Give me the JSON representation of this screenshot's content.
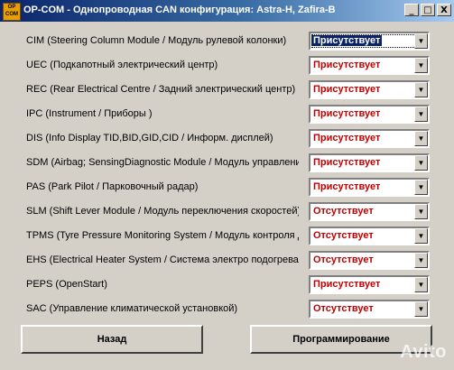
{
  "window": {
    "title": "OP-COM - Однопроводная  CAN конфигурация: Astra-H, Zafira-B",
    "app_icon_text": "OP COM",
    "controls": [
      "_",
      "□",
      "X"
    ]
  },
  "rows": [
    {
      "label": "CIM (Steering Column Module / Модуль рулевой колонки)",
      "value": "Присутствует"
    },
    {
      "label": "UEC (Подкапотный электрический центр)",
      "value": "Присутствует"
    },
    {
      "label": "REC (Rear Electrical Centre / Задний электрический центр)",
      "value": "Присутствует"
    },
    {
      "label": "IPC (Instrument / Приборы )",
      "value": "Присутствует"
    },
    {
      "label": "DIS (Info Display TID,BID,GID,CID / Информ. дисплей)",
      "value": "Присутствует"
    },
    {
      "label": "SDM (Airbag; SensingDiagnostic Module / Модуль управления",
      "value": "Присутствует"
    },
    {
      "label": "PAS (Park Pilot / Парковочный радар)",
      "value": "Присутствует"
    },
    {
      "label": "SLM (Shift Lever Module / Модуль переключения скоростей)",
      "value": "Отсутствует"
    },
    {
      "label": "TPMS (Tyre Pressure Monitoring System / Модуль контроля д",
      "value": "Отсутствует"
    },
    {
      "label": "EHS (Electrical Heater System / Система электро подогрева)",
      "value": "Отсутствует"
    },
    {
      "label": "PEPS (OpenStart)",
      "value": "Присутствует"
    },
    {
      "label": "SAC (Управление климатической установкой)",
      "value": "Отсутствует"
    }
  ],
  "dropdown_arrow": "▼",
  "buttons": {
    "back": "Назад",
    "program": "Программирование"
  },
  "watermark": "Avito",
  "colors": {
    "face": "#d4d0c8",
    "value_text": "#c00000",
    "focus_bg": "#0a246a"
  }
}
